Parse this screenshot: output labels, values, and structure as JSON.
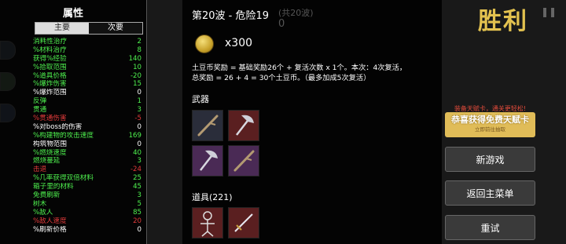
{
  "stats": {
    "faint_top": "",
    "title": "属性",
    "tabs": [
      {
        "label": "主要",
        "active": false
      },
      {
        "label": "次要",
        "active": true
      }
    ],
    "rows": [
      {
        "label": "消耗性治疗",
        "value": "2",
        "color": "#4ef04e"
      },
      {
        "label": "%材料治疗",
        "value": "8",
        "color": "#4ef04e"
      },
      {
        "label": "获得%经验",
        "value": "140",
        "color": "#4ef04e"
      },
      {
        "label": "%拾取范围",
        "value": "10",
        "color": "#4ef04e"
      },
      {
        "label": "%道具价格",
        "value": "-20",
        "color": "#4ef04e"
      },
      {
        "label": "%爆炸伤害",
        "value": "15",
        "color": "#4ef04e"
      },
      {
        "label": "%爆炸范围",
        "value": "0",
        "color": "#ffffff"
      },
      {
        "label": "反弹",
        "value": "1",
        "color": "#4ef04e"
      },
      {
        "label": "贯通",
        "value": "3",
        "color": "#4ef04e"
      },
      {
        "label": "%贯通伤害",
        "value": "-5",
        "color": "#e03a3a"
      },
      {
        "label": "%对boss的伤害",
        "value": "0",
        "color": "#ffffff"
      },
      {
        "label": "%构建物的攻击速度",
        "value": "169",
        "color": "#4ef04e"
      },
      {
        "label": "构筑物范围",
        "value": "0",
        "color": "#ffffff"
      },
      {
        "label": "%燃烧速度",
        "value": "40",
        "color": "#4ef04e"
      },
      {
        "label": "燃烧蔓延",
        "value": "3",
        "color": "#4ef04e"
      },
      {
        "label": "击退",
        "value": "-24",
        "color": "#e03a3a"
      },
      {
        "label": "%几率获得双倍材料",
        "value": "25",
        "color": "#4ef04e"
      },
      {
        "label": "箱子里的材料",
        "value": "45",
        "color": "#4ef04e"
      },
      {
        "label": "免费刷新",
        "value": "3",
        "color": "#4ef04e"
      },
      {
        "label": "树木",
        "value": "5",
        "color": "#4ef04e"
      },
      {
        "label": "%敌人",
        "value": "85",
        "color": "#4ef04e"
      },
      {
        "label": "%敌人速度",
        "value": "20",
        "color": "#e03a3a"
      },
      {
        "label": "%刷新价格",
        "value": "0",
        "color": "#ffffff"
      }
    ]
  },
  "wave": {
    "title": "第20波 - 危险19",
    "faint": "(共20波)",
    "faint_value": "0"
  },
  "reward": {
    "coin_count": "x300",
    "line1": "土豆币奖励 = 基础奖励26个 + 复活次数 x 1个。本次：4次复活，",
    "line2": "总奖励 = 26 + 4 = 30个土豆币。（最多加成5次复活）"
  },
  "weapons": {
    "label": "武器",
    "items": [
      {
        "icon": "stick-icon",
        "rarity": "white"
      },
      {
        "icon": "axe-icon",
        "rarity": "red"
      },
      {
        "icon": "axe-icon",
        "rarity": "purple"
      },
      {
        "icon": "stick-icon",
        "rarity": "purple"
      }
    ]
  },
  "items": {
    "label": "道具(221)",
    "entries": [
      {
        "icon": "skeleton-icon",
        "rarity": "red"
      },
      {
        "icon": "sword-icon",
        "rarity": "red"
      }
    ]
  },
  "right": {
    "victory": "胜利",
    "talent_hint": "装备天赋卡，通关更轻松!",
    "talent_main": "恭喜获得免费天赋卡",
    "talent_sub": "立即前往抽取",
    "new_game": "新游戏",
    "main_menu": "返回主菜单",
    "retry": "重试"
  },
  "colors": {
    "accent_gold": "#e3c24f",
    "positive": "#4ef04e",
    "negative": "#e03a3a"
  }
}
